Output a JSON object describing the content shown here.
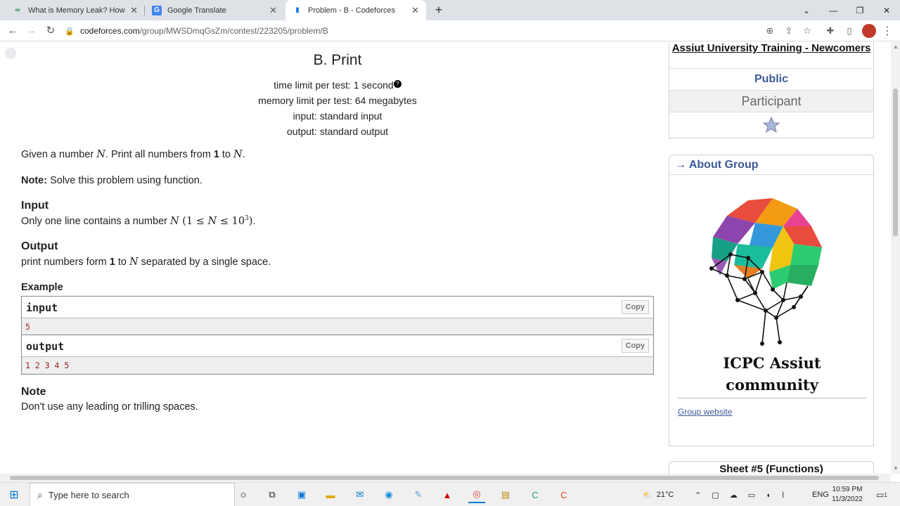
{
  "tabs": [
    {
      "title": "What is Memory Leak? How can",
      "favicon": "∞"
    },
    {
      "title": "Google Translate",
      "favicon": "G"
    },
    {
      "title": "Problem - B - Codeforces",
      "favicon": "▮"
    }
  ],
  "address": {
    "host": "codeforces.com",
    "path": "/group/MWSDmqGsZm/contest/223205/problem/B"
  },
  "problem": {
    "title": "B. Print",
    "time_limit": "time limit per test: 1 second",
    "memory_limit": "memory limit per test: 64 megabytes",
    "input_file": "input: standard input",
    "output_file": "output: standard output",
    "statement": {
      "p1": "Given a number ",
      "v1": "N",
      "p2": ". Print all numbers from ",
      "b1": "1",
      "p3": " to ",
      "v2": "N",
      "p4": "."
    },
    "note_label": "Note:",
    "note_text": " Solve this problem using function.",
    "input_title": "Input",
    "input_desc": {
      "p1": "Only one line contains a number ",
      "v1": "N",
      "m1": " (1 ≤ ",
      "v2": "N",
      "m2": " ≤ 10",
      "sup": "3",
      "m3": ")",
      "p2": "."
    },
    "output_title": "Output",
    "output_desc": {
      "p1": "print numbers form ",
      "b1": "1",
      "p2": " to ",
      "v1": "N",
      "p3": " separated by a single space."
    },
    "example_title": "Example",
    "sample_input_label": "input",
    "sample_input": "5",
    "sample_output_label": "output",
    "sample_output": "1 2 3 4 5",
    "copy_label": "Copy",
    "note_title": "Note",
    "note_body": "Don't use any leading or trilling spaces."
  },
  "sidebar": {
    "group_name": "Assiut University Training - Newcomers",
    "visibility": "Public",
    "role": "Participant",
    "about_title": "→ About Group",
    "logo_line1": "ICPC Assiut",
    "logo_line2": "community",
    "group_website": "Group website",
    "next_box_title": "Sheet #5 (Functions)"
  },
  "taskbar": {
    "search_placeholder": "Type here to search",
    "weather": "21°C",
    "lang": "ENG",
    "time": "10:59 PM",
    "date": "11/3/2022",
    "notif_count": "1"
  },
  "colors": {
    "link": "#3b5998",
    "sample_text": "#9b1c1c"
  }
}
